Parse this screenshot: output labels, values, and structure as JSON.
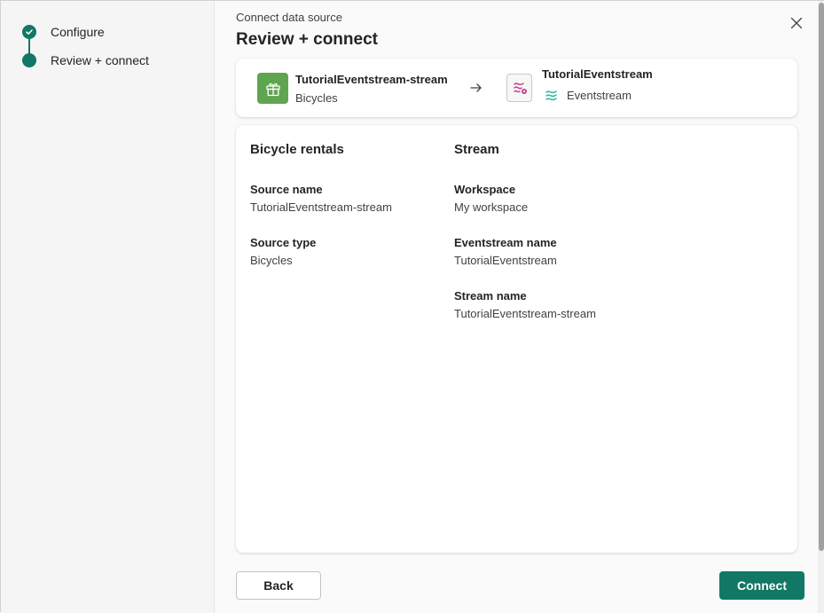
{
  "stepper": {
    "steps": [
      {
        "label": "Configure",
        "state": "completed"
      },
      {
        "label": "Review + connect",
        "state": "current"
      }
    ]
  },
  "header": {
    "subtitle": "Connect data source",
    "title": "Review + connect"
  },
  "flow": {
    "source": {
      "name": "TutorialEventstream-stream",
      "type": "Bicycles",
      "icon": "gift-icon"
    },
    "destination": {
      "name": "TutorialEventstream",
      "type": "Eventstream",
      "icon": "eventstream-icon"
    }
  },
  "details": {
    "left": {
      "title": "Bicycle rentals",
      "fields": [
        {
          "label": "Source name",
          "value": "TutorialEventstream-stream"
        },
        {
          "label": "Source type",
          "value": "Bicycles"
        }
      ]
    },
    "right": {
      "title": "Stream",
      "fields": [
        {
          "label": "Workspace",
          "value": "My workspace"
        },
        {
          "label": "Eventstream name",
          "value": "TutorialEventstream"
        },
        {
          "label": "Stream name",
          "value": "TutorialEventstream-stream"
        }
      ]
    }
  },
  "footer": {
    "back_label": "Back",
    "connect_label": "Connect"
  },
  "colors": {
    "accent": "#117865",
    "source_icon_bg": "#5fa550",
    "eventstream_pink": "#c73f8e",
    "eventstream_teal": "#2db8a6"
  }
}
